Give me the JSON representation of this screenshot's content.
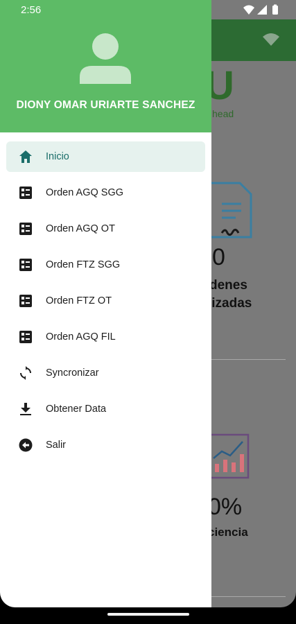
{
  "status_bar": {
    "time": "2:56",
    "icons": [
      "wifi-icon",
      "signal-icon",
      "battery-icon"
    ]
  },
  "drawer": {
    "header_color": "#5dbb66",
    "user_name": "DIONY OMAR URIARTE SANCHEZ",
    "items": [
      {
        "label": "Inicio",
        "icon": "home-icon",
        "active": true
      },
      {
        "label": "Orden AGQ SGG",
        "icon": "form-list-icon",
        "active": false
      },
      {
        "label": "Orden AGQ OT",
        "icon": "form-list-icon",
        "active": false
      },
      {
        "label": "Orden FTZ SGG",
        "icon": "form-list-icon",
        "active": false
      },
      {
        "label": "Orden FTZ OT",
        "icon": "form-list-icon",
        "active": false
      },
      {
        "label": "Orden AGQ FIL",
        "icon": "form-list-icon",
        "active": false
      },
      {
        "label": "Syncronizar",
        "icon": "sync-icon",
        "active": false
      },
      {
        "label": "Obtener Data",
        "icon": "download-icon",
        "active": false
      },
      {
        "label": "Salir",
        "icon": "exit-icon",
        "active": false
      }
    ]
  },
  "background": {
    "logo_letter": "U",
    "logo_sub": "head",
    "card1": {
      "value": "0",
      "label_line1": "denes",
      "label_line2": "lizadas"
    },
    "card2": {
      "value": "0%",
      "label": "ciencia"
    },
    "accent_color": "#2c6b33"
  }
}
